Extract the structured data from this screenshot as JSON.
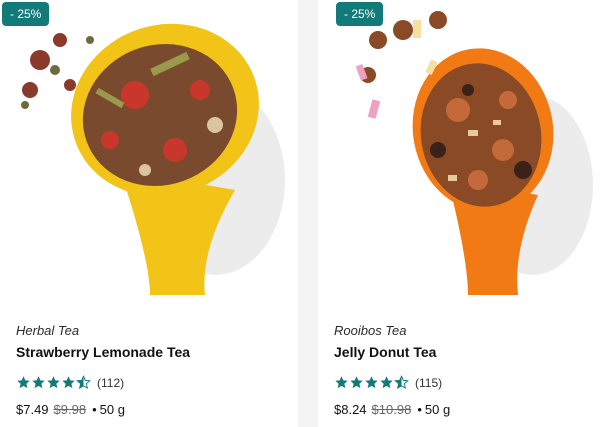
{
  "products": [
    {
      "badge": "- 25%",
      "category": "Herbal Tea",
      "name": "Strawberry Lemonade Tea",
      "rating": 4.5,
      "reviews": "(112)",
      "price": "$7.49",
      "old_price": "$9.98",
      "separator": "•",
      "weight": "50 g",
      "scoop_color": "#f2c418"
    },
    {
      "badge": "- 25%",
      "category": "Rooibos Tea",
      "name": "Jelly Donut Tea",
      "rating": 4.5,
      "reviews": "(115)",
      "price": "$8.24",
      "old_price": "$10.98",
      "separator": "•",
      "weight": "50 g",
      "scoop_color": "#f27a14"
    }
  ],
  "colors": {
    "badge": "#137a7a",
    "star": "#137a7a"
  }
}
